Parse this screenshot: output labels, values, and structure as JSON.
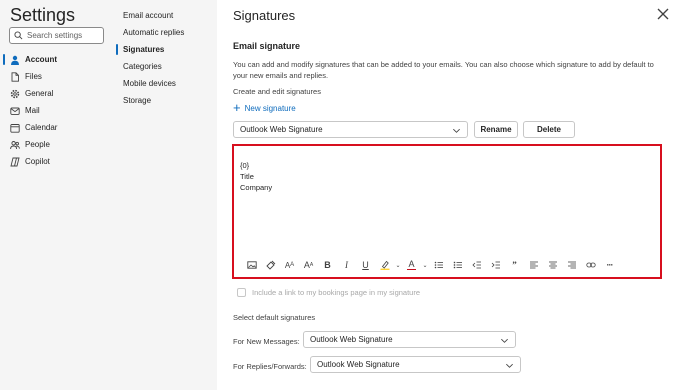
{
  "nav": {
    "title": "Settings",
    "search": {
      "placeholder": "Search settings",
      "value": ""
    },
    "items": [
      {
        "label": "Account",
        "icon": "person-icon"
      },
      {
        "label": "Files",
        "icon": "file-icon"
      },
      {
        "label": "General",
        "icon": "gear-icon"
      },
      {
        "label": "Mail",
        "icon": "mail-icon"
      },
      {
        "label": "Calendar",
        "icon": "calendar-icon"
      },
      {
        "label": "People",
        "icon": "people-icon"
      },
      {
        "label": "Copilot",
        "icon": "copilot-icon"
      }
    ]
  },
  "subnav": {
    "items": [
      {
        "label": "Email account"
      },
      {
        "label": "Automatic replies"
      },
      {
        "label": "Signatures"
      },
      {
        "label": "Categories"
      },
      {
        "label": "Mobile devices"
      },
      {
        "label": "Storage"
      }
    ]
  },
  "main": {
    "title": "Signatures",
    "section_title": "Email signature",
    "description": "You can add and modify signatures that can be added to your emails. You can also choose which signature to add by default to your new emails and replies.",
    "create_label": "Create and edit signatures",
    "new_signature_label": "New signature",
    "signature_select": {
      "value": "Outlook Web Signature"
    },
    "rename_label": "Rename",
    "delete_label": "Delete",
    "editor": {
      "lines": [
        "{0}",
        "Title",
        "Company"
      ]
    },
    "checkbox_label": "Include a link to my bookings page in my signature",
    "defaults_label": "Select default signatures",
    "new_messages": {
      "label": "For New Messages:",
      "value": "Outlook Web Signature"
    },
    "replies": {
      "label": "For Replies/Forwards:",
      "value": "Outlook Web Signature"
    }
  },
  "colors": {
    "accent": "#0f6cbd",
    "highlight_border": "#d70f1e",
    "nav_bg": "#f5f5f5",
    "font_color_red": "#c50f1f",
    "highlighter_yellow": "#ffd335"
  }
}
